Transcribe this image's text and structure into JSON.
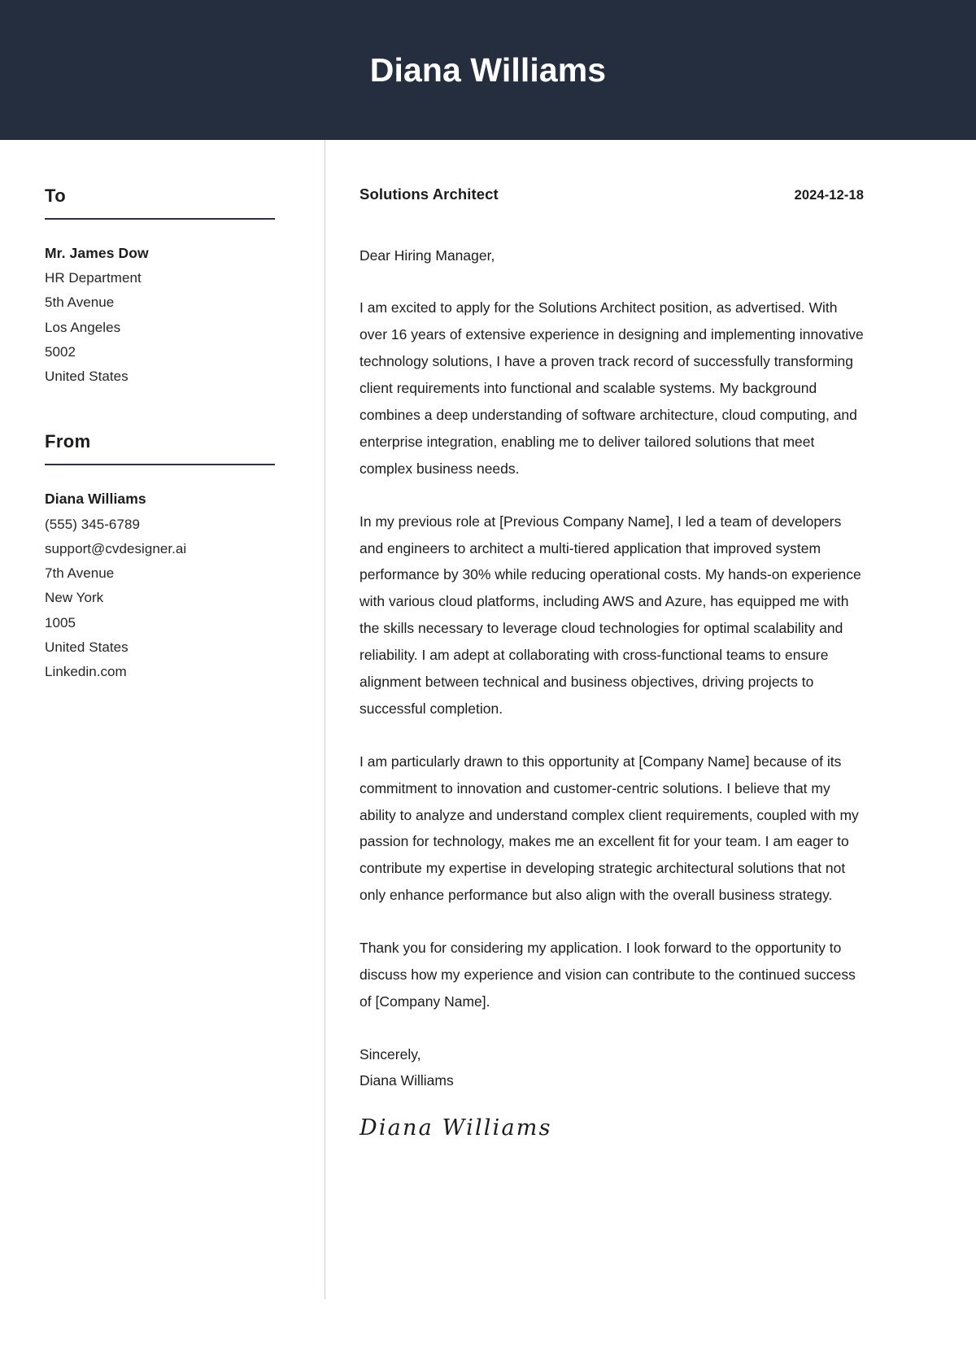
{
  "document": {
    "type": "cover-letter",
    "header": {
      "name": "Diana Williams",
      "background_color": "#242e3f",
      "text_color": "#ffffff"
    },
    "sidebar": {
      "to": {
        "heading": "To",
        "name": "Mr. James Dow",
        "lines": [
          "HR Department",
          "5th Avenue",
          "Los Angeles",
          "5002",
          "United States"
        ]
      },
      "from": {
        "heading": "From",
        "name": "Diana Williams",
        "lines": [
          "(555) 345-6789",
          "support@cvdesigner.ai",
          "7th Avenue",
          "New York",
          "1005",
          "United States",
          "Linkedin.com"
        ]
      }
    },
    "letter": {
      "job_title": "Solutions Architect",
      "date": "2024-12-18",
      "salutation": "Dear Hiring Manager,",
      "paragraphs": [
        "I am excited to apply for the Solutions Architect position, as advertised. With over 16 years of extensive experience in designing and implementing innovative technology solutions, I have a proven track record of successfully transforming client requirements into functional and scalable systems. My background combines a deep understanding of software architecture, cloud computing, and enterprise integration, enabling me to deliver tailored solutions that meet complex business needs.",
        "In my previous role at [Previous Company Name], I led a team of developers and engineers to architect a multi-tiered application that improved system performance by 30% while reducing operational costs. My hands-on experience with various cloud platforms, including AWS and Azure, has equipped me with the skills necessary to leverage cloud technologies for optimal scalability and reliability. I am adept at collaborating with cross-functional teams to ensure alignment between technical and business objectives, driving projects to successful completion.",
        "I am particularly drawn to this opportunity at [Company Name] because of its commitment to innovation and customer-centric solutions. I believe that my ability to analyze and understand complex client requirements, coupled with my passion for technology, makes me an excellent fit for your team. I am eager to contribute my expertise in developing strategic architectural solutions that not only enhance performance but also align with the overall business strategy.",
        "Thank you for considering my application. I look forward to the opportunity to discuss how my experience and vision can contribute to the continued success of [Company Name]."
      ],
      "closing_word": "Sincerely,",
      "closing_name": "Diana Williams",
      "signature": "Diana Williams"
    }
  }
}
